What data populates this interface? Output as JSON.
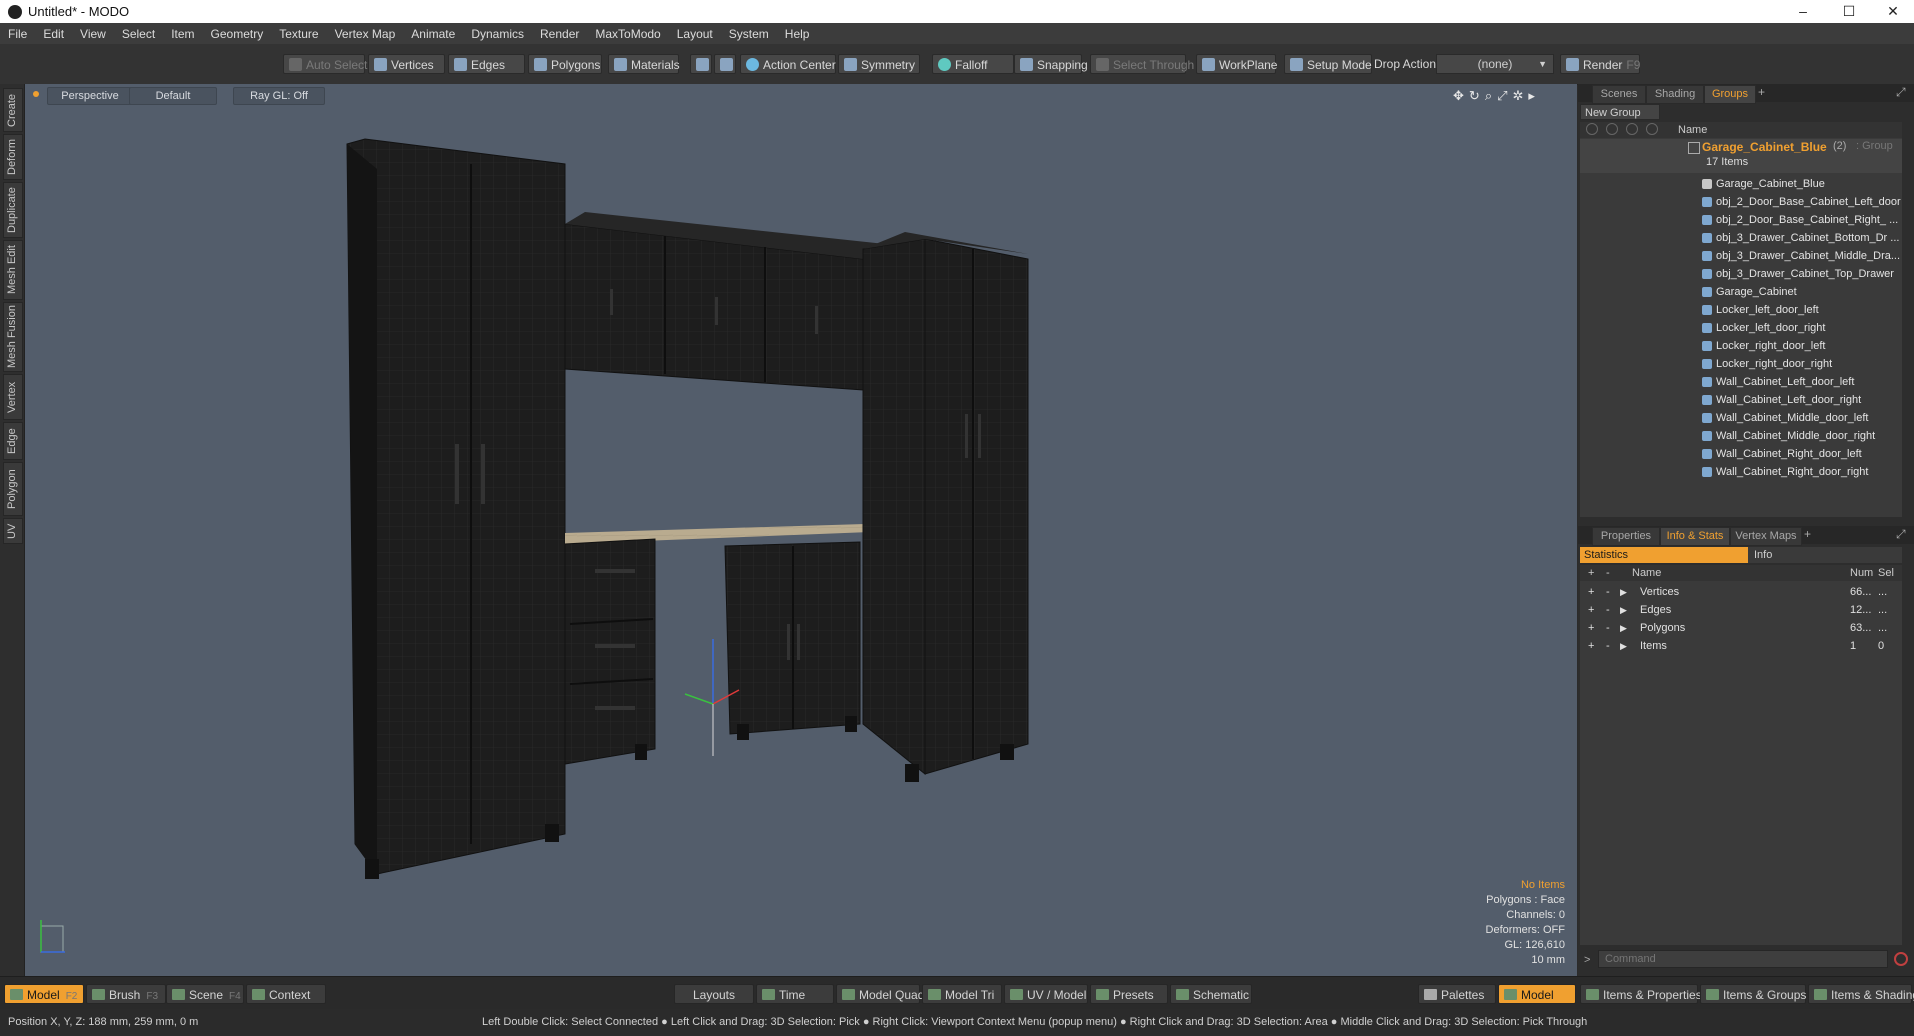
{
  "window": {
    "title": "Untitled* - MODO",
    "minimize": "–",
    "maximize": "☐",
    "close": "✕"
  },
  "menu": [
    "File",
    "Edit",
    "View",
    "Select",
    "Item",
    "Geometry",
    "Texture",
    "Vertex Map",
    "Animate",
    "Dynamics",
    "Render",
    "MaxToModo",
    "Layout",
    "System",
    "Help"
  ],
  "toolbar": {
    "auto_select": "Auto Select",
    "vertices": "Vertices",
    "edges": "Edges",
    "polygons": "Polygons",
    "materials": "Materials",
    "action_center": "Action Center",
    "symmetry": "Symmetry",
    "falloff": "Falloff",
    "snapping": "Snapping",
    "select_through": "Select Through",
    "workplane": "WorkPlane",
    "setup_mode": "Setup Mode",
    "drop_action_label": "Drop Action",
    "drop_action_value": "(none)",
    "render": "Render",
    "render_key": "F9"
  },
  "left_tabs": [
    "Create",
    "Deform",
    "Duplicate",
    "Mesh Edit",
    "Mesh Fusion",
    "Vertex",
    "Edge",
    "Polygon",
    "UV"
  ],
  "viewport": {
    "view": "Perspective",
    "shading": "Default",
    "raygl": "Ray GL: Off",
    "info": {
      "no_items": "No Items",
      "polygons": "Polygons : Face",
      "channels": "Channels: 0",
      "deformers": "Deformers: OFF",
      "gl": "GL: 126,610",
      "scale": "10 mm"
    }
  },
  "scene_panel": {
    "tabs": [
      "Scenes",
      "Shading",
      "Groups"
    ],
    "active_tab": "Groups",
    "new_group": "New Group",
    "name_header": "Name",
    "group": {
      "name": "Garage_Cabinet_Blue",
      "count": "(2)",
      "type": ": Group",
      "items": "17 Items"
    },
    "items": [
      "Garage_Cabinet_Blue",
      "obj_2_Door_Base_Cabinet_Left_door",
      "obj_2_Door_Base_Cabinet_Right_ ...",
      "obj_3_Drawer_Cabinet_Bottom_Dr ...",
      "obj_3_Drawer_Cabinet_Middle_Dra...",
      "obj_3_Drawer_Cabinet_Top_Drawer",
      "Garage_Cabinet",
      "Locker_left_door_left",
      "Locker_left_door_right",
      "Locker_right_door_left",
      "Locker_right_door_right",
      "Wall_Cabinet_Left_door_left",
      "Wall_Cabinet_Left_door_right",
      "Wall_Cabinet_Middle_door_left",
      "Wall_Cabinet_Middle_door_right",
      "Wall_Cabinet_Right_door_left",
      "Wall_Cabinet_Right_door_right"
    ]
  },
  "props_panel": {
    "tabs": [
      "Properties",
      "Info & Stats",
      "Vertex Maps"
    ],
    "active_tab": "Info & Stats",
    "subtabs": [
      "Statistics",
      "Info"
    ],
    "headers": {
      "name": "Name",
      "num": "Num",
      "sel": "Sel"
    },
    "rows": [
      {
        "name": "Vertices",
        "num": "66...",
        "sel": "..."
      },
      {
        "name": "Edges",
        "num": "12...",
        "sel": "..."
      },
      {
        "name": "Polygons",
        "num": "63...",
        "sel": "..."
      },
      {
        "name": "Items",
        "num": "1",
        "sel": "0"
      }
    ],
    "command_placeholder": "Command"
  },
  "bottombar": {
    "model": "Model",
    "model_key": "F2",
    "brush": "Brush",
    "brush_key": "F3",
    "scene": "Scene",
    "scene_key": "F4",
    "context": "Context",
    "layouts": "Layouts",
    "time": "Time",
    "model_quad": "Model Quad",
    "model_tri": "Model Tri",
    "uv_model": "UV / Model",
    "presets": "Presets",
    "schematic": "Schematic",
    "palettes": "Palettes",
    "model2": "Model",
    "items_props": "Items & Properties",
    "items_groups": "Items & Groups",
    "items_shading": "Items & Shading"
  },
  "status": {
    "position": "Position X, Y, Z:   188 mm, 259 mm, 0 m",
    "hints": "Left Double Click: Select Connected ● Left Click and Drag: 3D Selection: Pick ● Right Click: Viewport Context Menu (popup menu) ● Right Click and Drag: 3D Selection: Area ● Middle Click and Drag: 3D Selection: Pick Through"
  },
  "colors": {
    "accent": "#f0a030",
    "viewport_bg": "#535d6b",
    "cabinet": "#1d1d1d",
    "countertop": "#b9ab8f"
  }
}
